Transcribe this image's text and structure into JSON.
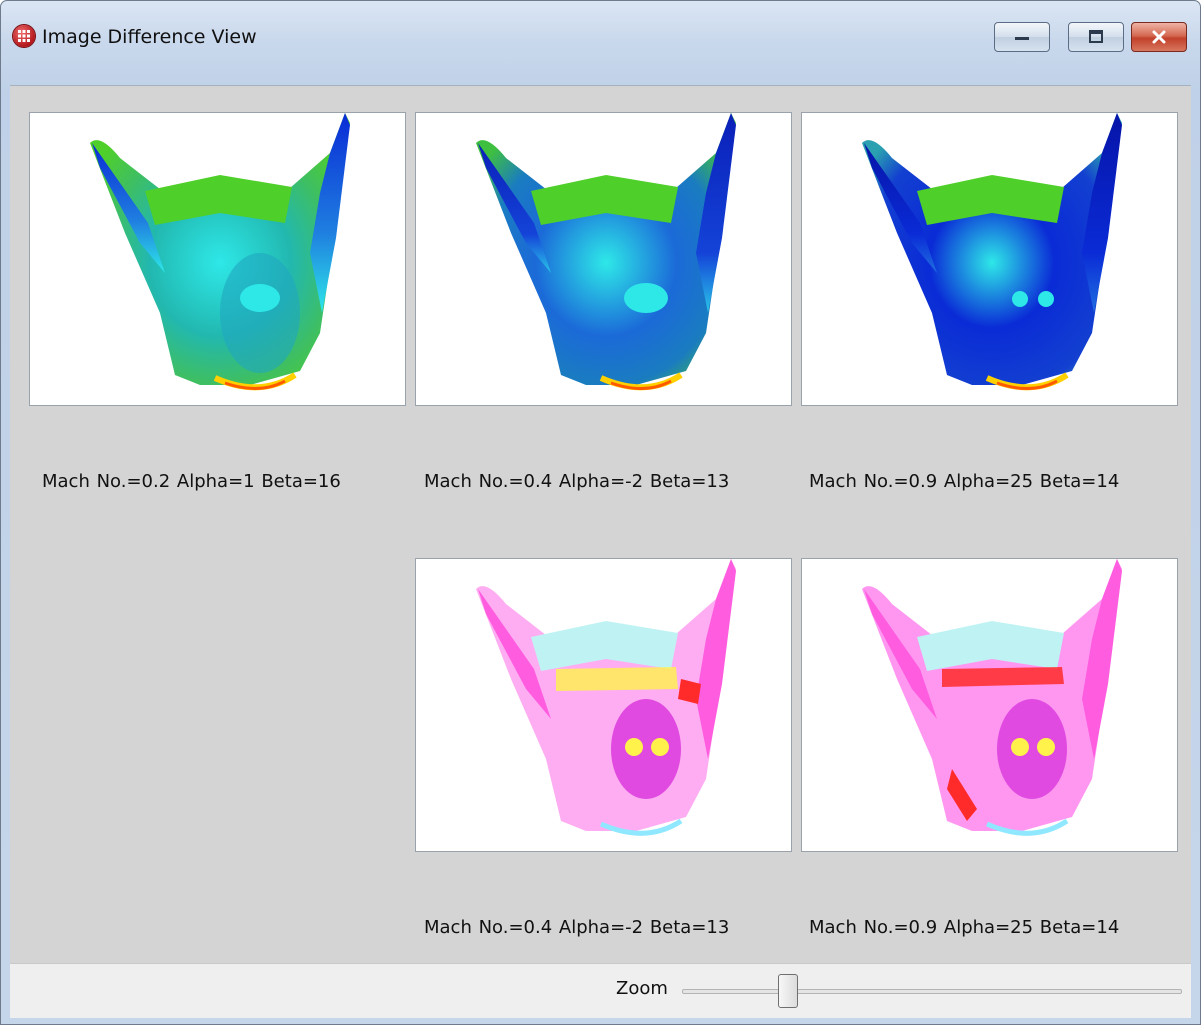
{
  "window": {
    "title": "Image Difference View",
    "icon": "grid-globe-icon",
    "controls": [
      "minimize-icon",
      "maximize-icon",
      "close-icon"
    ]
  },
  "panels": [
    {
      "caption": "Mach No.=0.2  Alpha=1  Beta=16",
      "colormap": "jet"
    },
    {
      "caption": "Mach No.=0.4  Alpha=-2  Beta=13",
      "colormap": "jet"
    },
    {
      "caption": "Mach No.=0.9  Alpha=25  Beta=14",
      "colormap": "jet"
    },
    {
      "caption": "Mach No.=0.4  Alpha=-2  Beta=13",
      "colormap": "difference"
    },
    {
      "caption": "Mach No.=0.9  Alpha=25  Beta=14",
      "colormap": "difference"
    }
  ],
  "zoom": {
    "label": "Zoom",
    "value": 0.2
  },
  "colors": {
    "background": "#d4d4d4",
    "jet_green": "#4fcf2a",
    "jet_blue": "#0a2bd6",
    "jet_cyan": "#2ee8e8",
    "diff_magenta": "#ff5ce0",
    "diff_yellow": "#fff24a",
    "diff_red": "#ff2a2a"
  }
}
